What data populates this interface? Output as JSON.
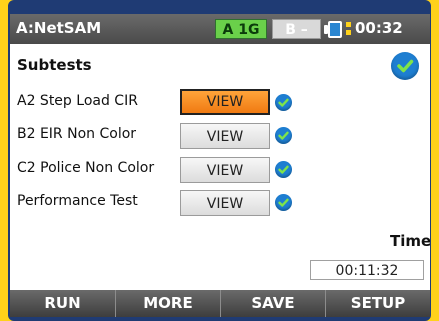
{
  "header": {
    "app_title": "A:NetSAM",
    "port_a": "A 1G",
    "port_b": "B –",
    "clock": "00:32"
  },
  "subtests": {
    "title": "Subtests",
    "rows": [
      {
        "label": "A2 Step Load CIR",
        "button": "VIEW",
        "selected": true
      },
      {
        "label": "B2 EIR Non Color",
        "button": "VIEW",
        "selected": false
      },
      {
        "label": "C2 Police Non Color",
        "button": "VIEW",
        "selected": false
      },
      {
        "label": "Performance Test",
        "button": "VIEW",
        "selected": false
      }
    ]
  },
  "time": {
    "label": "Time",
    "value": "00:11:32"
  },
  "bottom_buttons": [
    "RUN",
    "MORE",
    "SAVE",
    "SETUP"
  ],
  "colors": {
    "accent_orange": "#f07a12",
    "check_blue": "#1e7ed1",
    "port_green": "#6ad04a",
    "frame_yellow": "#ffd21a"
  },
  "icons": {
    "status": "check-circle-icon",
    "row_status": "check-circle-icon",
    "battery": "battery-icon"
  }
}
